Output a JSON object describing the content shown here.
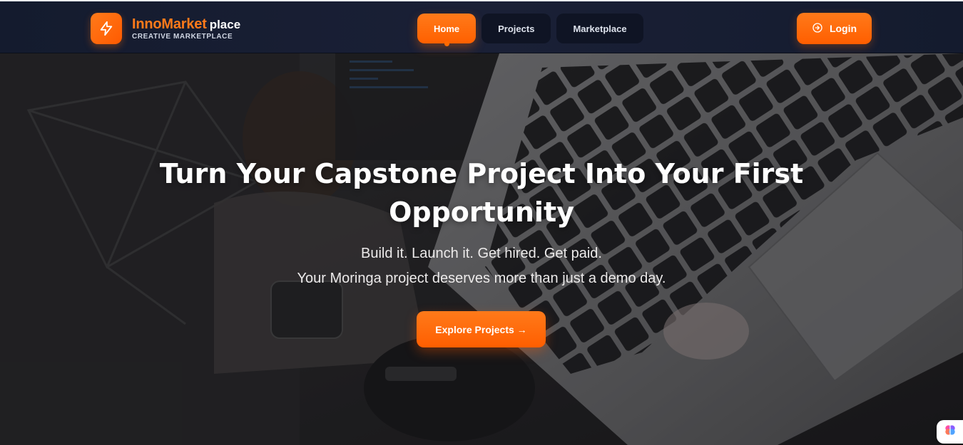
{
  "brand": {
    "name_primary": "InnoMarket",
    "name_secondary": "place",
    "tagline": "CREATIVE MARKETPLACE",
    "icon": "lightning-bolt-icon",
    "accent_color": "#ff6a00"
  },
  "nav": {
    "items": [
      {
        "label": "Home",
        "active": true
      },
      {
        "label": "Projects",
        "active": false
      },
      {
        "label": "Marketplace",
        "active": false
      }
    ],
    "login_label": "Login",
    "login_icon": "sign-in-icon"
  },
  "hero": {
    "title": "Turn Your Capstone Project Into Your First Opportunity",
    "subtitle_1": "Build it. Launch it. Get hired. Get paid.",
    "subtitle_2": "Your Moringa project deserves more than just a demo day.",
    "cta_label": "Explore Projects →",
    "background": "photo of person working at laptop with mouse"
  },
  "assistant": {
    "icon": "brain-icon"
  }
}
